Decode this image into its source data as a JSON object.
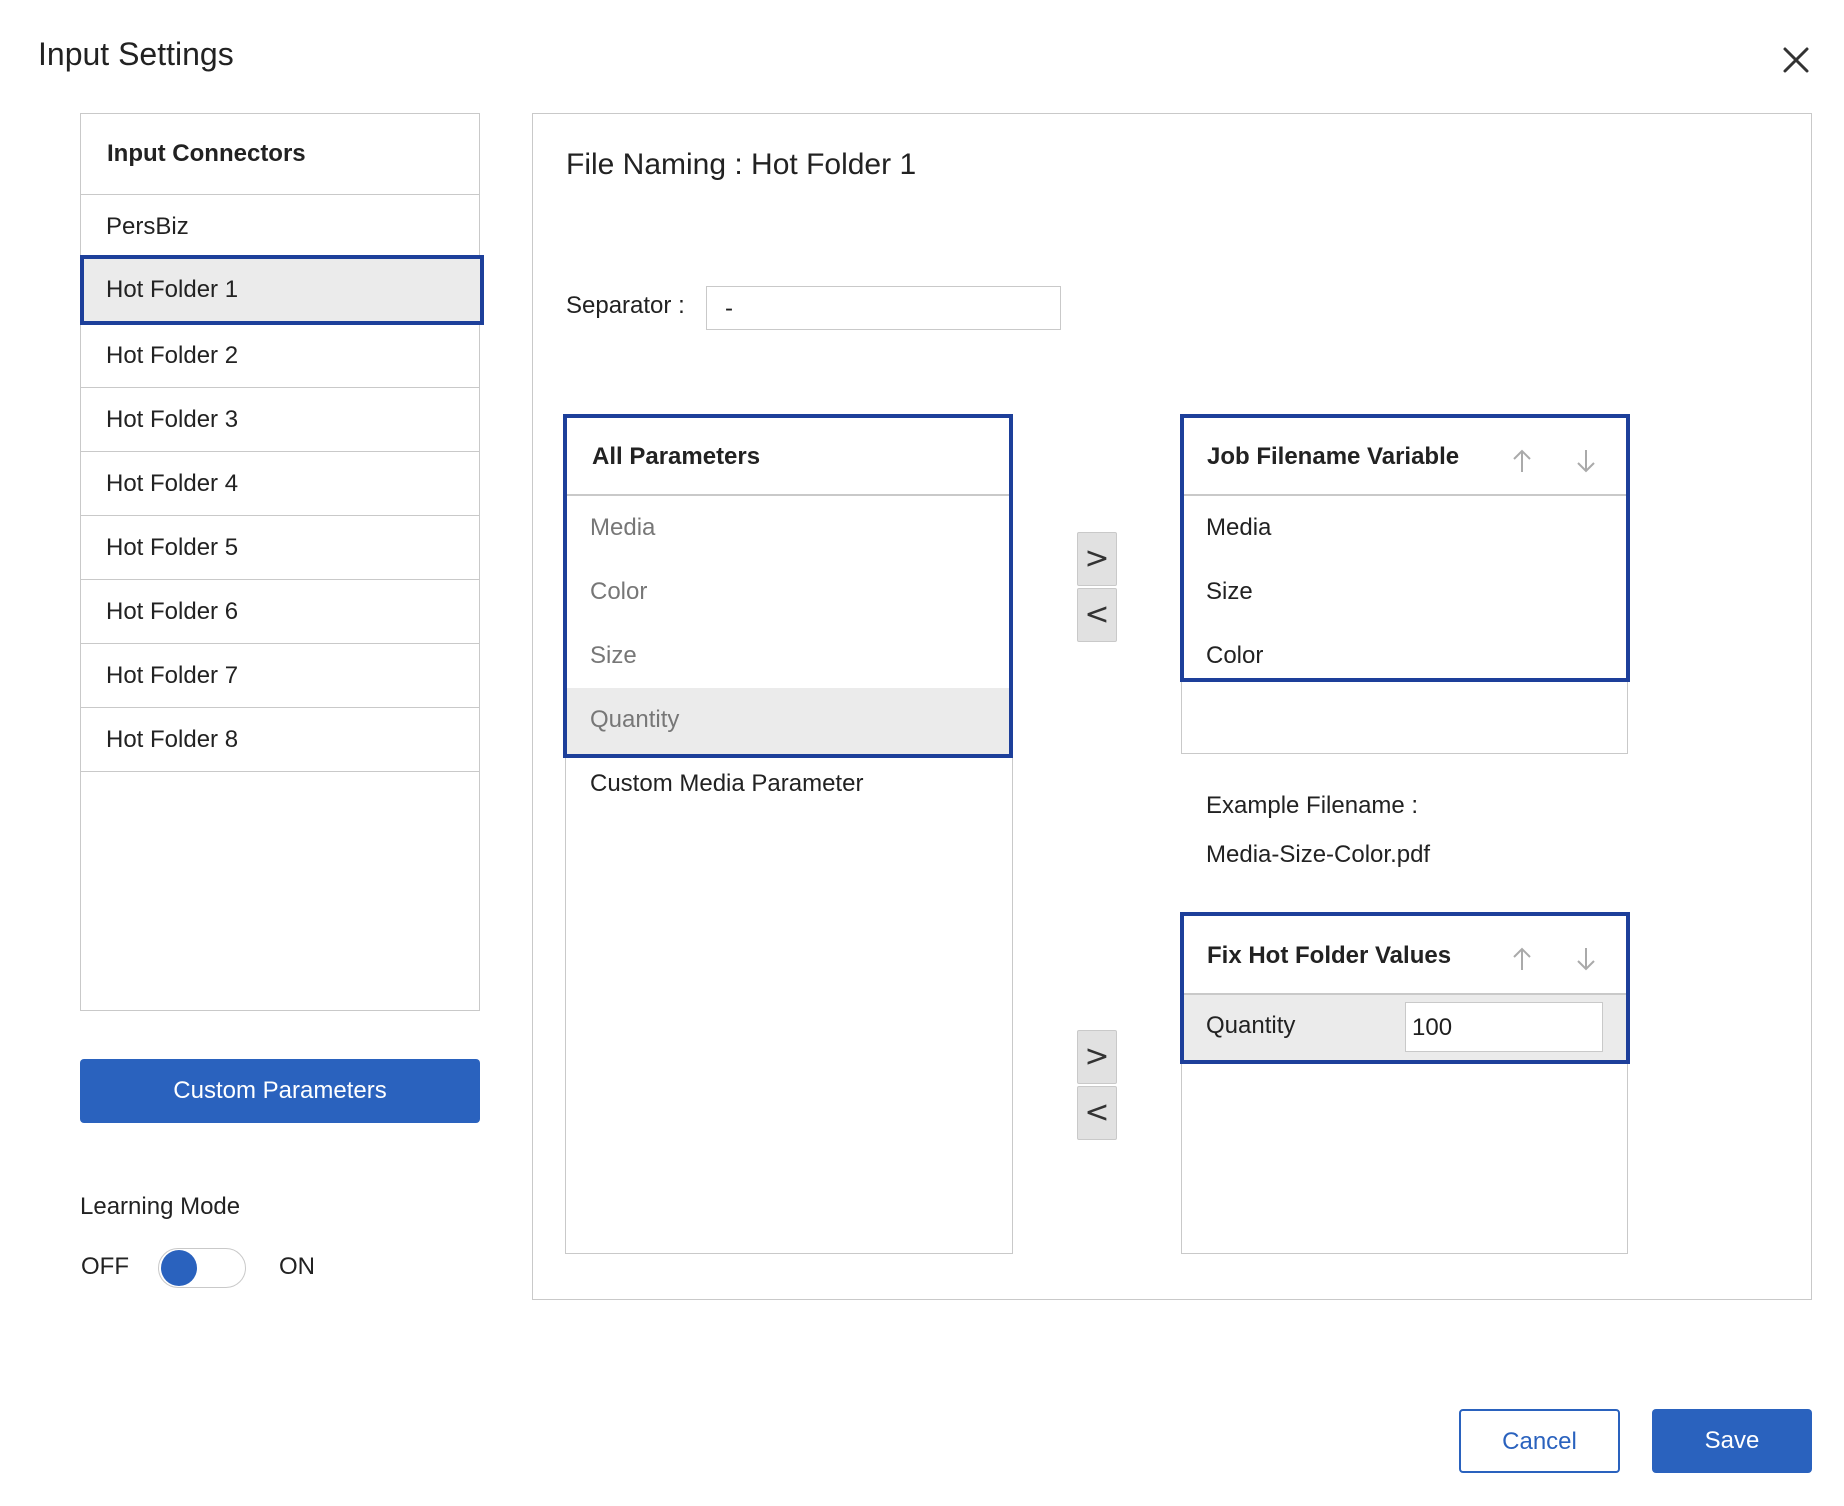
{
  "dialog": {
    "title": "Input Settings"
  },
  "connectors": {
    "header": "Input Connectors",
    "items": [
      "PersBiz",
      "Hot Folder 1",
      "Hot Folder 2",
      "Hot Folder 3",
      "Hot Folder 4",
      "Hot Folder 5",
      "Hot Folder 6",
      "Hot Folder 7",
      "Hot Folder 8"
    ],
    "selected": "Hot Folder 1"
  },
  "custom_parameters_label": "Custom Parameters",
  "learning_mode": {
    "label": "Learning Mode",
    "off_label": "OFF",
    "on_label": "ON",
    "state": "OFF"
  },
  "file_naming": {
    "title": "File Naming : Hot Folder 1",
    "separator_label": "Separator :",
    "separator_value": "-",
    "all_parameters": {
      "header": "All Parameters",
      "items": [
        "Media",
        "Color",
        "Size",
        "Quantity"
      ],
      "extra_item": "Custom Media Parameter",
      "selected": "Quantity"
    },
    "move_right": ">",
    "move_left": "<",
    "job_filename_variable": {
      "header": "Job Filename Variable",
      "items": [
        "Media",
        "Size",
        "Color"
      ]
    },
    "example_label": "Example Filename :",
    "example_value": "Media-Size-Color.pdf",
    "fix_hot_folder_values": {
      "header": "Fix Hot Folder Values",
      "row_label": "Quantity",
      "row_value": "100"
    }
  },
  "footer": {
    "cancel_label": "Cancel",
    "save_label": "Save"
  },
  "colors": {
    "accent": "#2a62be",
    "selection_border": "#1d3f9a",
    "selected_bg": "#ebebeb",
    "border": "#c9c9c9"
  },
  "icons": [
    "close-icon",
    "arrow-up-icon",
    "arrow-down-icon"
  ]
}
